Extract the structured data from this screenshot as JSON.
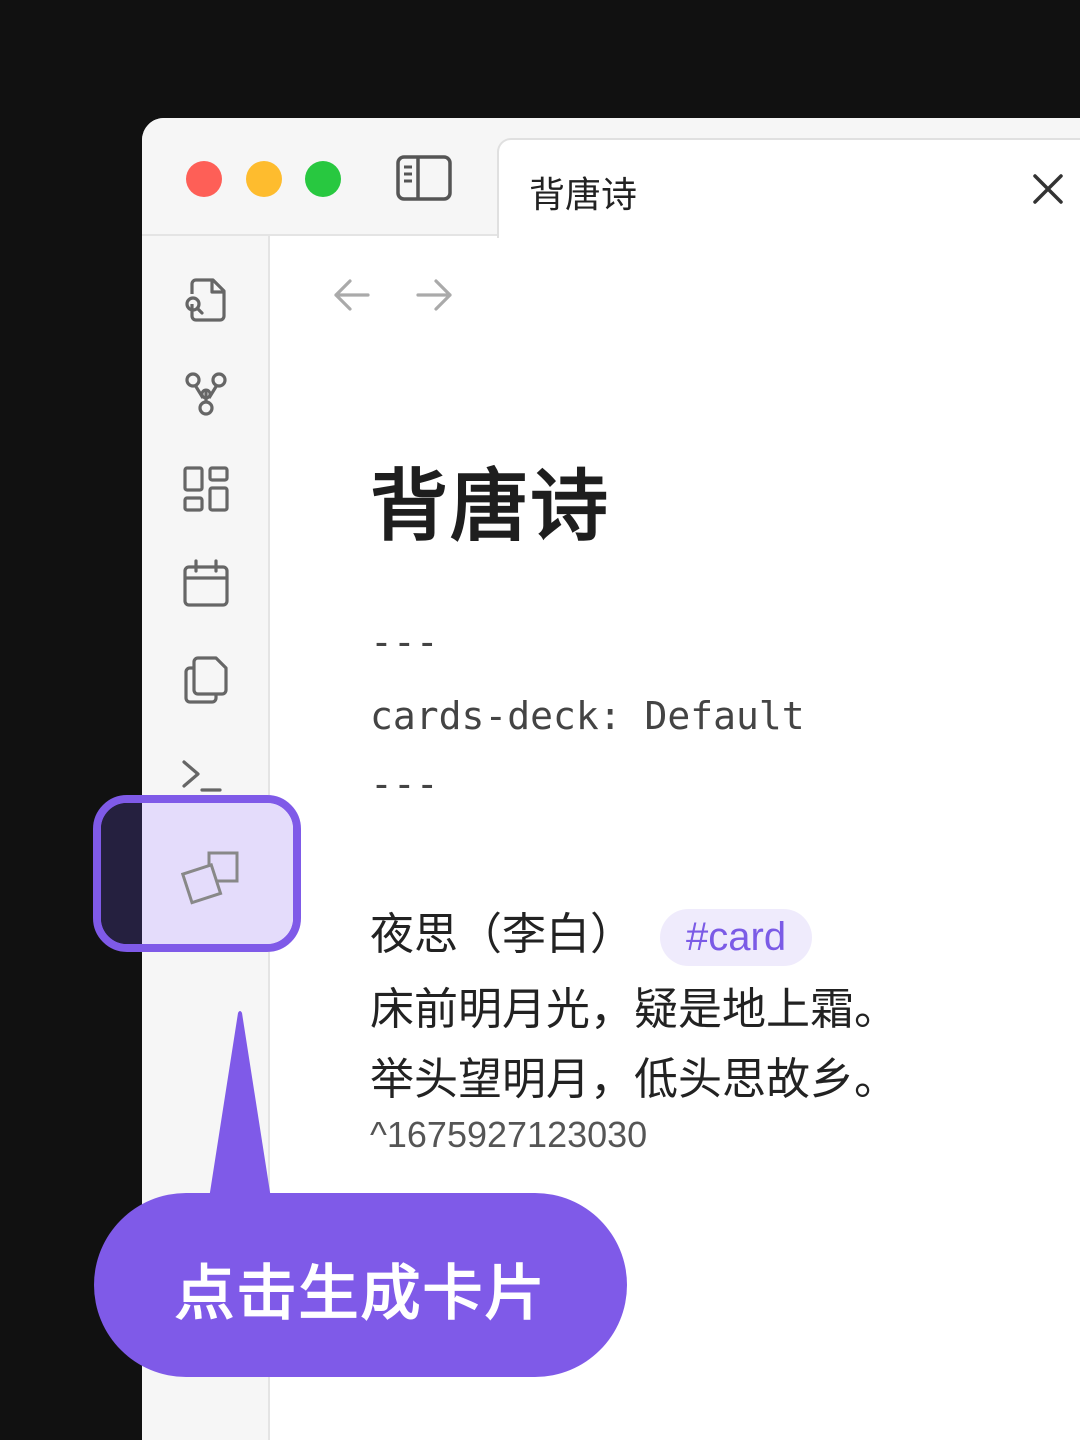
{
  "window": {
    "tab_title": "背唐诗",
    "traffic_lights": {
      "close": "#fe5f57",
      "minimize": "#febc2e",
      "maximize": "#28c840"
    }
  },
  "ribbon": {
    "icons": [
      "search-file-icon",
      "graph-view-icon",
      "dashboard-icon",
      "calendar-icon",
      "copy-icon",
      "terminal-icon",
      "flashcards-icon"
    ]
  },
  "document": {
    "title": "背唐诗",
    "frontmatter_open": "---",
    "frontmatter_line": "cards-deck: Default",
    "frontmatter_close": "---",
    "poem_heading": "夜思（李白）",
    "tag": "#card",
    "line1": "床前明月光，疑是地上霜。",
    "line2": "举头望明月，低头思故乡。",
    "block_id": "^1675927123030"
  },
  "callout": {
    "text": "点击生成卡片",
    "color": "#7f5ae8"
  }
}
